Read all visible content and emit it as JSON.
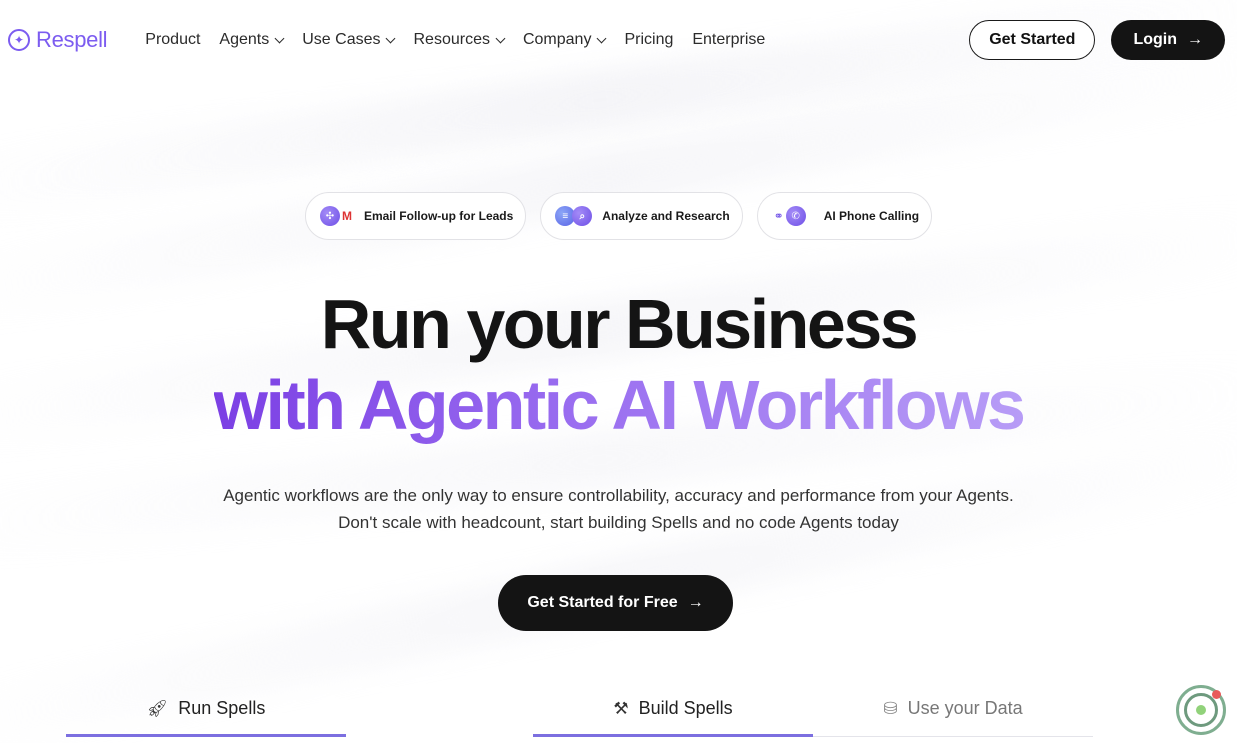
{
  "brand": {
    "name": "Respell",
    "logo_icon": "sparkle-icon",
    "accent": "#7c5cf0"
  },
  "nav": {
    "items": [
      {
        "label": "Product",
        "dropdown": false
      },
      {
        "label": "Agents",
        "dropdown": true
      },
      {
        "label": "Use Cases",
        "dropdown": true
      },
      {
        "label": "Resources",
        "dropdown": true
      },
      {
        "label": "Company",
        "dropdown": true
      },
      {
        "label": "Pricing",
        "dropdown": false
      },
      {
        "label": "Enterprise",
        "dropdown": false
      }
    ],
    "get_started": "Get Started",
    "login": "Login"
  },
  "chips": [
    {
      "label": "Email Follow-up for Leads"
    },
    {
      "label": "Analyze and Research"
    },
    {
      "label": "AI Phone Calling"
    }
  ],
  "hero": {
    "line1": "Run your Business",
    "line2": "with Agentic AI Workflows",
    "sub1": "Agentic workflows are the only way to ensure controllability, accuracy and performance from your Agents.",
    "sub2": "Don't scale with headcount, start building Spells and no code Agents today",
    "cta": "Get Started for Free"
  },
  "tabs": [
    {
      "label": "Run Spells",
      "icon": "rocket-icon",
      "active": true
    },
    {
      "label": "Build Spells",
      "icon": "hammer-icon",
      "active": true
    },
    {
      "label": "Use your Data",
      "icon": "database-icon",
      "active": false
    }
  ],
  "colors": {
    "dark": "#141414",
    "gradient_start": "#7b3fe4",
    "gradient_end": "#b79cf6",
    "tab_underline": "#7c6fe0"
  }
}
